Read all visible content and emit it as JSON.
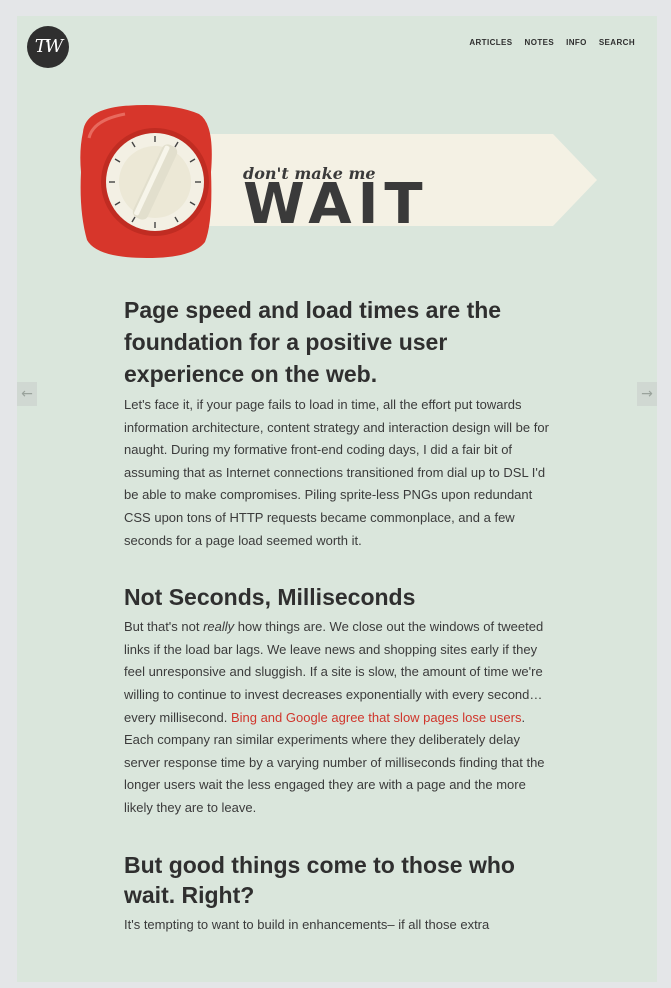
{
  "header": {
    "logo_text": "TW",
    "nav": [
      "ARTICLES",
      "NOTES",
      "INFO",
      "SEARCH"
    ]
  },
  "hero": {
    "tagline": "don't make me",
    "title": "WAIT"
  },
  "pager": {
    "prev_icon": "←",
    "next_icon": "→"
  },
  "article": {
    "heading1": "Page speed and load times are the foundation for a positive user experience on the web.",
    "para1": "Let's face it, if your page fails to load in time, all the effort put towards information architecture, content strategy and interaction design will be for naught. During my formative front-end coding days, I did a fair bit of assuming that as Internet connections transitioned from dial up to DSL I'd be able to make compromises. Piling sprite-less PNGs upon redundant CSS upon tons of HTTP requests became commonplace, and a few seconds for a page load seemed worth it.",
    "heading2": "Not Seconds, Milliseconds",
    "para2_a": "But that's not ",
    "para2_em": "really",
    "para2_b": " how things are.  We close out the windows of tweeted links if the load bar lags.  We leave news and shopping sites early if they feel unresponsive and sluggish.  If a site is slow, the amount of time we're willing to continue to invest decreases exponentially with every second… every millisecond. ",
    "para2_link": "Bing and Google agree that slow pages lose users",
    "para2_c": ". Each company ran similar experiments where they deliberately delay server response time by a varying number of milliseconds finding that the longer users wait the less engaged they are with a page and the more likely they are to leave.",
    "heading3": "But good things come to those who wait. Right?",
    "para3": "It's tempting to want to build in enhancements– if all those extra"
  },
  "colors": {
    "page_bg": "#dae6dc",
    "timer_red": "#d7362b",
    "banner": "#f4f1e4",
    "text_dark": "#2f2f2f",
    "link": "#d0362c"
  }
}
